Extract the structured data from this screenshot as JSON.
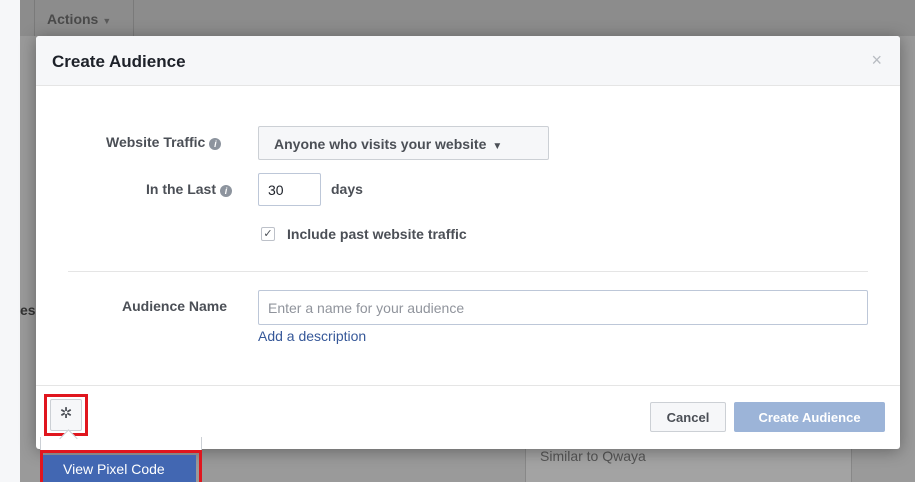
{
  "background": {
    "actions_label": "Actions",
    "side_text": "es",
    "panel_text": "Similar to Qwaya"
  },
  "modal": {
    "title": "Create Audience",
    "close_glyph": "×",
    "website_traffic_label": "Website Traffic",
    "website_traffic_value": "Anyone who visits your website",
    "in_the_last_label": "In the Last",
    "days_value": "30",
    "days_label": "days",
    "include_past_label": "Include past website traffic",
    "include_past_checked": true,
    "audience_name_label": "Audience Name",
    "audience_name_value": "",
    "audience_name_placeholder": "Enter a name for your audience",
    "add_description_label": "Add a description",
    "cancel_label": "Cancel",
    "create_label": "Create Audience"
  },
  "popover": {
    "view_pixel_code_label": "View Pixel Code"
  },
  "icons": {
    "gear": "gear-icon",
    "info": "info-icon",
    "close": "close-icon",
    "caret": "caret-down-icon",
    "check": "checkmark-icon"
  },
  "colors": {
    "primary_button": "#4267b2",
    "disabled_primary": "#9cb4d8",
    "link": "#365899",
    "highlight": "#e0161e"
  }
}
